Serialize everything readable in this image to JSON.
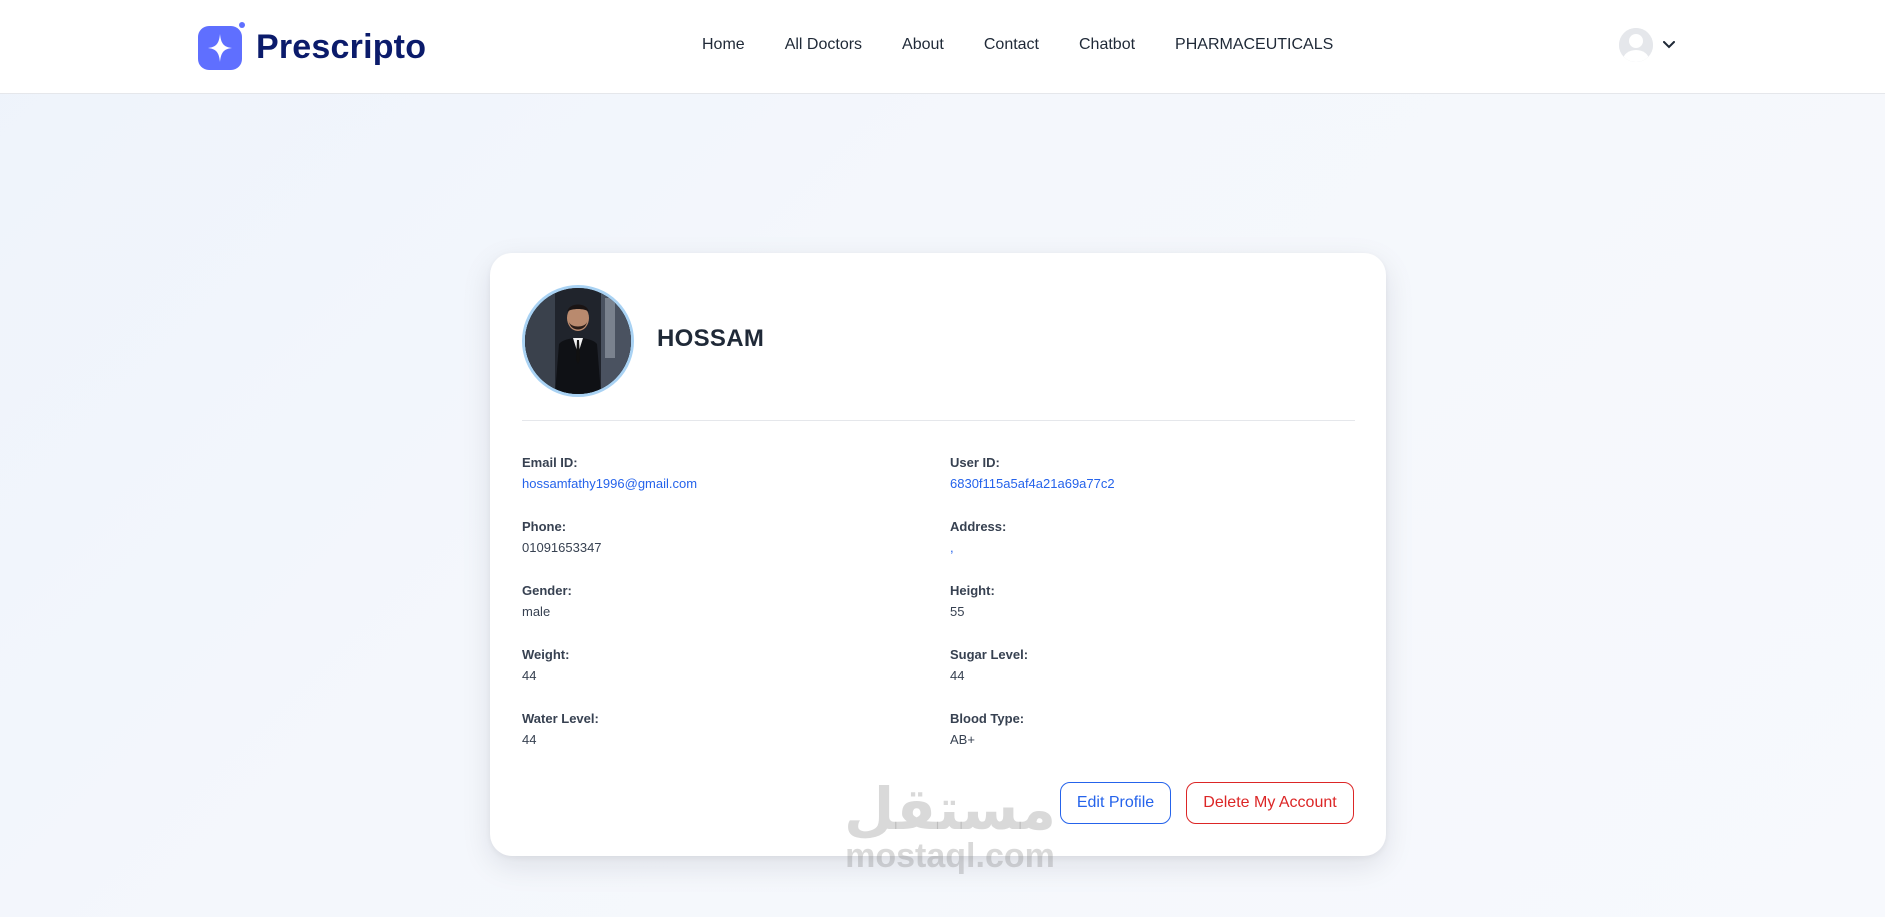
{
  "brand": {
    "name": "Prescripto",
    "logo_color": "#5f6fff",
    "text_color": "#0b1b6b"
  },
  "nav": {
    "items": [
      {
        "label": "Home"
      },
      {
        "label": "All Doctors"
      },
      {
        "label": "About"
      },
      {
        "label": "Contact"
      },
      {
        "label": "Chatbot"
      },
      {
        "label": "PHARMACEUTICALS"
      }
    ],
    "user_menu_icon": "chevron-down-icon"
  },
  "profile": {
    "name": "HOSSAM",
    "fields": [
      {
        "label": "Email ID:",
        "value": "hossamfathy1996@gmail.com",
        "style": "link"
      },
      {
        "label": "User ID:",
        "value": "6830f115a5af4a21a69a77c2",
        "style": "link"
      },
      {
        "label": "Phone:",
        "value": "01091653347",
        "style": "plain"
      },
      {
        "label": "Address:",
        "value": ",",
        "style": "link"
      },
      {
        "label": "Gender:",
        "value": "male",
        "style": "plain"
      },
      {
        "label": "Height:",
        "value": "55",
        "style": "plain"
      },
      {
        "label": "Weight:",
        "value": "44",
        "style": "plain"
      },
      {
        "label": "Sugar Level:",
        "value": "44",
        "style": "plain"
      },
      {
        "label": "Water Level:",
        "value": "44",
        "style": "plain"
      },
      {
        "label": "Blood Type:",
        "value": "AB+",
        "style": "plain"
      }
    ]
  },
  "actions": {
    "edit_label": "Edit Profile",
    "delete_label": "Delete My Account",
    "edit_color": "#2563eb",
    "delete_color": "#dc2626"
  },
  "watermark": {
    "arabic": "مستقل",
    "latin": "mostaql.com"
  }
}
